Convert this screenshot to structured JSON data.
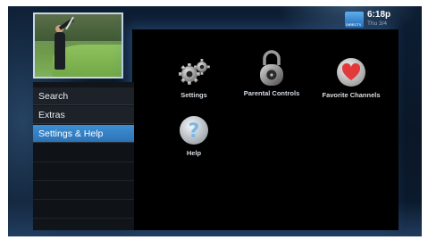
{
  "clock": {
    "time": "6:18p",
    "date": "Thu 3/4",
    "logo_text": "DIRECTV"
  },
  "menu": {
    "items": [
      {
        "label": "Search"
      },
      {
        "label": "Extras"
      },
      {
        "label": "Settings & Help",
        "selected": true
      }
    ]
  },
  "tiles": [
    {
      "label": "Settings",
      "icon": "gears-icon"
    },
    {
      "label": "Parental Controls",
      "icon": "padlock-icon"
    },
    {
      "label": "Favorite Channels",
      "icon": "heart-icon"
    },
    {
      "label": "Help",
      "icon": "question-mark-icon"
    }
  ],
  "colors": {
    "selected_item": "#3d8fd4",
    "heart": "#e23a3a",
    "help": "#7ab6e8"
  }
}
